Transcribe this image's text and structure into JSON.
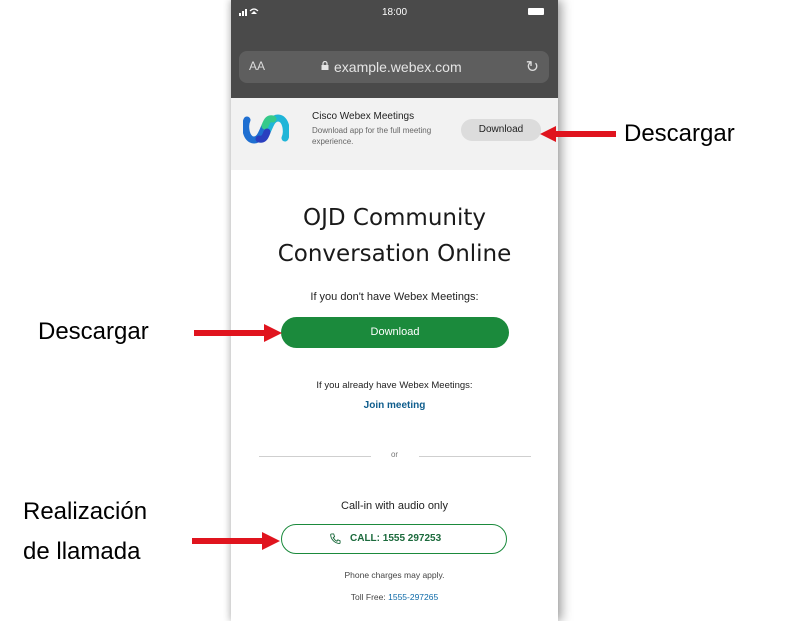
{
  "status": {
    "time": "18:00"
  },
  "browser": {
    "aa_label": "AA",
    "url": "example.webex.com"
  },
  "banner": {
    "app_name": "Cisco Webex Meetings",
    "app_desc": "Download app for the full meeting experience.",
    "button": "Download"
  },
  "page": {
    "title_line1": "OJD Community",
    "title_line2": "Conversation Online",
    "prompt_no_app": "If you don't have Webex Meetings:",
    "download_button": "Download",
    "prompt_have_app": "If you already have Webex Meetings:",
    "join_link": "Join meeting",
    "or": "or",
    "callin_label": "Call-in with audio only",
    "call_button": "CALL: 1555 297253",
    "charges_note": "Phone charges may apply.",
    "tollfree_label": "Toll Free: ",
    "tollfree_number": "1555-297265"
  },
  "annotations": {
    "banner_download": "Descargar",
    "main_download": "Descargar",
    "call_line1": "Realización",
    "call_line2": "de llamada"
  },
  "colors": {
    "accent_green": "#1b8a3c",
    "link_blue": "#0d5c8c",
    "arrow_red": "#e0141e"
  },
  "icons": [
    "signal-icon",
    "wifi-icon",
    "battery-icon",
    "lock-icon",
    "reload-icon",
    "webex-logo",
    "phone-icon",
    "red-arrow-icon"
  ]
}
